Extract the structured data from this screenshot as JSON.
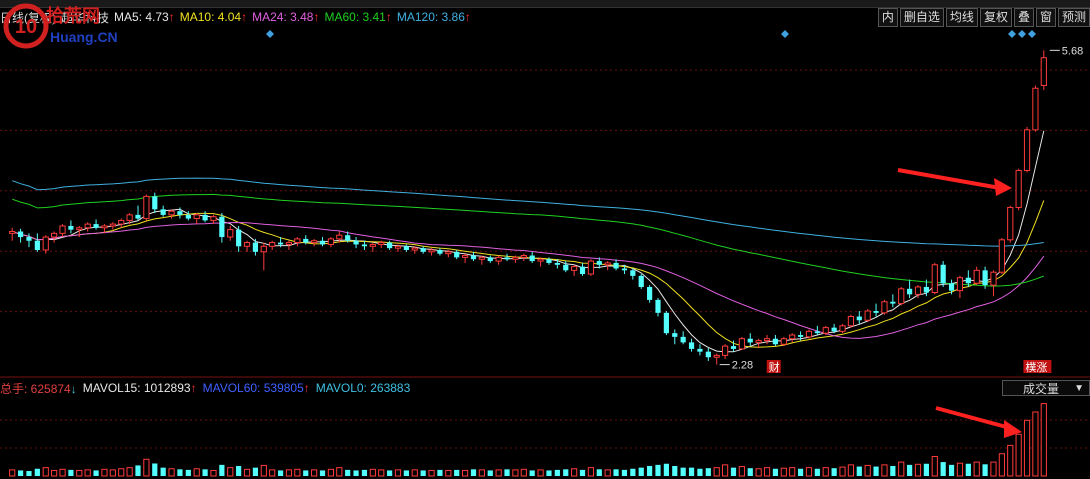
{
  "header": {
    "period": "日线(复权)",
    "stock_name": "超华科技",
    "ma5": "MA5: 4.73",
    "ma10": "MA10: 4.04",
    "ma24": "MA24: 3.48",
    "ma60": "MA60: 3.41",
    "ma120": "MA120: 3.86",
    "arrow": "↑"
  },
  "toolbar": [
    "内",
    "删自选",
    "均线",
    "复权",
    "叠",
    "窗",
    "预测"
  ],
  "chart_labels": {
    "high": "5.68",
    "low": "2.28",
    "cai": "财",
    "zhangting": "樸涨"
  },
  "volume_bar": {
    "total": "总手: 625874",
    "total_arrow": "↓",
    "mavol15": "MAVOL15: 1012893",
    "mavol60": "MAVOL60: 539805",
    "mavol0": "MAVOL0: 263883",
    "arrow": "↑",
    "selector": "成交量"
  },
  "watermark": {
    "brand": "拾荒网",
    "domain": "Huang.CN"
  },
  "chart_data": {
    "type": "candlestick",
    "ylim": [
      2.2,
      5.9
    ],
    "candles": [
      [
        3.7,
        3.76,
        3.62,
        3.72
      ],
      [
        3.72,
        3.75,
        3.6,
        3.66
      ],
      [
        3.66,
        3.7,
        3.55,
        3.62
      ],
      [
        3.62,
        3.7,
        3.5,
        3.52
      ],
      [
        3.52,
        3.68,
        3.48,
        3.66
      ],
      [
        3.66,
        3.72,
        3.6,
        3.7
      ],
      [
        3.7,
        3.8,
        3.66,
        3.78
      ],
      [
        3.78,
        3.84,
        3.7,
        3.74
      ],
      [
        3.74,
        3.78,
        3.66,
        3.76
      ],
      [
        3.76,
        3.82,
        3.72,
        3.8
      ],
      [
        3.8,
        3.85,
        3.74,
        3.76
      ],
      [
        3.76,
        3.8,
        3.7,
        3.78
      ],
      [
        3.78,
        3.82,
        3.74,
        3.8
      ],
      [
        3.8,
        3.86,
        3.76,
        3.84
      ],
      [
        3.84,
        3.92,
        3.8,
        3.9
      ],
      [
        3.9,
        4.0,
        3.84,
        3.86
      ],
      [
        3.86,
        4.12,
        3.84,
        4.1
      ],
      [
        4.1,
        4.14,
        3.92,
        3.96
      ],
      [
        3.96,
        4.0,
        3.88,
        3.9
      ],
      [
        3.9,
        3.96,
        3.86,
        3.94
      ],
      [
        3.94,
        3.98,
        3.86,
        3.9
      ],
      [
        3.9,
        3.94,
        3.84,
        3.86
      ],
      [
        3.86,
        3.92,
        3.8,
        3.9
      ],
      [
        3.9,
        3.94,
        3.82,
        3.84
      ],
      [
        3.84,
        3.9,
        3.8,
        3.88
      ],
      [
        3.88,
        3.92,
        3.6,
        3.66
      ],
      [
        3.66,
        3.78,
        3.62,
        3.74
      ],
      [
        3.74,
        3.78,
        3.5,
        3.56
      ],
      [
        3.56,
        3.62,
        3.5,
        3.6
      ],
      [
        3.6,
        3.64,
        3.46,
        3.5
      ],
      [
        3.5,
        3.6,
        3.3,
        3.56
      ],
      [
        3.56,
        3.62,
        3.52,
        3.6
      ],
      [
        3.6,
        3.66,
        3.55,
        3.58
      ],
      [
        3.58,
        3.62,
        3.52,
        3.6
      ],
      [
        3.6,
        3.66,
        3.56,
        3.64
      ],
      [
        3.64,
        3.68,
        3.58,
        3.6
      ],
      [
        3.6,
        3.64,
        3.56,
        3.62
      ],
      [
        3.62,
        3.66,
        3.56,
        3.58
      ],
      [
        3.58,
        3.66,
        3.55,
        3.64
      ],
      [
        3.64,
        3.72,
        3.6,
        3.68
      ],
      [
        3.68,
        3.72,
        3.6,
        3.62
      ],
      [
        3.62,
        3.66,
        3.54,
        3.58
      ],
      [
        3.58,
        3.62,
        3.52,
        3.56
      ],
      [
        3.56,
        3.6,
        3.5,
        3.58
      ],
      [
        3.58,
        3.62,
        3.54,
        3.6
      ],
      [
        3.6,
        3.62,
        3.52,
        3.54
      ],
      [
        3.54,
        3.58,
        3.5,
        3.56
      ],
      [
        3.56,
        3.58,
        3.5,
        3.52
      ],
      [
        3.52,
        3.56,
        3.48,
        3.54
      ],
      [
        3.54,
        3.56,
        3.48,
        3.5
      ],
      [
        3.5,
        3.54,
        3.46,
        3.52
      ],
      [
        3.52,
        3.54,
        3.46,
        3.48
      ],
      [
        3.48,
        3.52,
        3.44,
        3.5
      ],
      [
        3.5,
        3.52,
        3.42,
        3.44
      ],
      [
        3.44,
        3.48,
        3.38,
        3.46
      ],
      [
        3.46,
        3.5,
        3.4,
        3.42
      ],
      [
        3.42,
        3.46,
        3.36,
        3.44
      ],
      [
        3.44,
        3.46,
        3.38,
        3.4
      ],
      [
        3.4,
        3.46,
        3.36,
        3.44
      ],
      [
        3.44,
        3.48,
        3.4,
        3.42
      ],
      [
        3.42,
        3.46,
        3.38,
        3.44
      ],
      [
        3.44,
        3.48,
        3.4,
        3.46
      ],
      [
        3.46,
        3.5,
        3.38,
        3.4
      ],
      [
        3.4,
        3.44,
        3.34,
        3.42
      ],
      [
        3.42,
        3.44,
        3.36,
        3.38
      ],
      [
        3.38,
        3.42,
        3.32,
        3.36
      ],
      [
        3.36,
        3.4,
        3.28,
        3.3
      ],
      [
        3.3,
        3.36,
        3.24,
        3.34
      ],
      [
        3.34,
        3.38,
        3.24,
        3.26
      ],
      [
        3.26,
        3.42,
        3.24,
        3.4
      ],
      [
        3.4,
        3.44,
        3.32,
        3.36
      ],
      [
        3.36,
        3.4,
        3.3,
        3.38
      ],
      [
        3.38,
        3.42,
        3.3,
        3.32
      ],
      [
        3.32,
        3.36,
        3.26,
        3.3
      ],
      [
        3.3,
        3.32,
        3.2,
        3.24
      ],
      [
        3.24,
        3.26,
        3.1,
        3.12
      ],
      [
        3.12,
        3.14,
        2.95,
        2.98
      ],
      [
        2.98,
        3.0,
        2.8,
        2.84
      ],
      [
        2.84,
        2.86,
        2.6,
        2.62
      ],
      [
        2.62,
        2.66,
        2.5,
        2.58
      ],
      [
        2.58,
        2.64,
        2.5,
        2.52
      ],
      [
        2.52,
        2.56,
        2.42,
        2.45
      ],
      [
        2.45,
        2.5,
        2.38,
        2.42
      ],
      [
        2.42,
        2.46,
        2.32,
        2.36
      ],
      [
        2.36,
        2.4,
        2.28,
        2.38
      ],
      [
        2.38,
        2.5,
        2.34,
        2.48
      ],
      [
        2.48,
        2.54,
        2.42,
        2.45
      ],
      [
        2.45,
        2.58,
        2.44,
        2.56
      ],
      [
        2.56,
        2.62,
        2.48,
        2.52
      ],
      [
        2.52,
        2.56,
        2.46,
        2.54
      ],
      [
        2.54,
        2.6,
        2.5,
        2.56
      ],
      [
        2.56,
        2.6,
        2.48,
        2.5
      ],
      [
        2.5,
        2.58,
        2.48,
        2.56
      ],
      [
        2.56,
        2.62,
        2.52,
        2.6
      ],
      [
        2.6,
        2.64,
        2.54,
        2.58
      ],
      [
        2.58,
        2.66,
        2.56,
        2.64
      ],
      [
        2.64,
        2.7,
        2.6,
        2.62
      ],
      [
        2.62,
        2.7,
        2.6,
        2.68
      ],
      [
        2.68,
        2.72,
        2.62,
        2.64
      ],
      [
        2.64,
        2.72,
        2.62,
        2.7
      ],
      [
        2.7,
        2.82,
        2.68,
        2.8
      ],
      [
        2.8,
        2.86,
        2.72,
        2.76
      ],
      [
        2.76,
        2.88,
        2.74,
        2.86
      ],
      [
        2.86,
        2.94,
        2.8,
        2.84
      ],
      [
        2.84,
        2.98,
        2.82,
        2.96
      ],
      [
        2.96,
        3.04,
        2.9,
        2.94
      ],
      [
        2.94,
        3.12,
        2.92,
        3.1
      ],
      [
        3.1,
        3.2,
        3.0,
        3.04
      ],
      [
        3.04,
        3.14,
        3.0,
        3.12
      ],
      [
        3.12,
        3.2,
        3.02,
        3.06
      ],
      [
        3.06,
        3.38,
        3.04,
        3.36
      ],
      [
        3.36,
        3.4,
        3.12,
        3.16
      ],
      [
        3.16,
        3.2,
        3.04,
        3.08
      ],
      [
        3.08,
        3.24,
        3.0,
        3.22
      ],
      [
        3.22,
        3.3,
        3.12,
        3.16
      ],
      [
        3.16,
        3.34,
        3.14,
        3.3
      ],
      [
        3.3,
        3.34,
        3.1,
        3.14
      ],
      [
        3.14,
        3.3,
        3.02,
        3.28
      ],
      [
        3.28,
        3.65,
        3.26,
        3.63
      ],
      [
        3.63,
        4.0,
        3.6,
        3.98
      ],
      [
        3.98,
        4.4,
        3.95,
        4.38
      ],
      [
        4.38,
        4.85,
        4.36,
        4.82
      ],
      [
        4.82,
        5.3,
        4.8,
        5.27
      ],
      [
        5.3,
        5.68,
        5.25,
        5.6
      ]
    ],
    "volumes": [
      0.22,
      0.2,
      0.18,
      0.26,
      0.3,
      0.2,
      0.24,
      0.22,
      0.2,
      0.22,
      0.2,
      0.24,
      0.22,
      0.26,
      0.3,
      0.38,
      0.6,
      0.45,
      0.3,
      0.26,
      0.24,
      0.22,
      0.26,
      0.24,
      0.2,
      0.4,
      0.3,
      0.36,
      0.24,
      0.3,
      0.38,
      0.22,
      0.2,
      0.22,
      0.24,
      0.2,
      0.22,
      0.2,
      0.24,
      0.3,
      0.22,
      0.2,
      0.22,
      0.24,
      0.22,
      0.2,
      0.22,
      0.2,
      0.22,
      0.2,
      0.2,
      0.22,
      0.2,
      0.22,
      0.2,
      0.24,
      0.22,
      0.2,
      0.22,
      0.24,
      0.22,
      0.24,
      0.2,
      0.22,
      0.2,
      0.22,
      0.24,
      0.26,
      0.22,
      0.3,
      0.24,
      0.22,
      0.24,
      0.22,
      0.26,
      0.3,
      0.36,
      0.4,
      0.44,
      0.36,
      0.3,
      0.3,
      0.26,
      0.28,
      0.3,
      0.4,
      0.3,
      0.34,
      0.28,
      0.26,
      0.3,
      0.26,
      0.28,
      0.3,
      0.26,
      0.3,
      0.26,
      0.3,
      0.28,
      0.32,
      0.4,
      0.34,
      0.38,
      0.34,
      0.4,
      0.36,
      0.5,
      0.4,
      0.42,
      0.44,
      0.7,
      0.5,
      0.4,
      0.46,
      0.44,
      0.5,
      0.42,
      0.5,
      0.8,
      1.1,
      1.5,
      2.0,
      2.3,
      2.6
    ],
    "ma_series": [
      {
        "name": "MA5",
        "color": "#e8e8e8"
      },
      {
        "name": "MA10",
        "color": "#f0e020"
      },
      {
        "name": "MA24",
        "color": "#e060e0"
      },
      {
        "name": "MA60",
        "color": "#20d020"
      },
      {
        "name": "MA120",
        "color": "#40b0e0"
      }
    ]
  }
}
